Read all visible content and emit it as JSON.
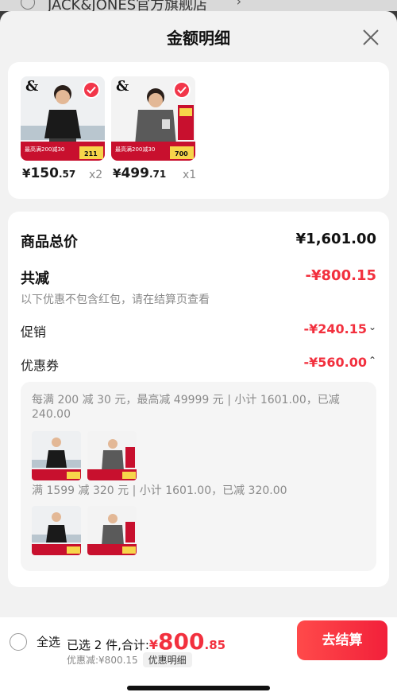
{
  "background_page": {
    "store_name": "JACK&JONES官方旗舰店"
  },
  "sheet": {
    "title": "金额明细"
  },
  "products": [
    {
      "price_yen": "¥",
      "price_int": "150",
      "price_dec": ".57",
      "qty": "x2",
      "label": "black shirt",
      "brand": "&",
      "promo": "最高满200减30",
      "tag": "211"
    },
    {
      "price_yen": "¥",
      "price_int": "499",
      "price_dec": ".71",
      "qty": "x1",
      "label": "grey down jacket",
      "brand": "&",
      "promo": "最高满200减30",
      "tag": "700"
    }
  ],
  "summary": {
    "total_label": "商品总价",
    "total_value": "¥1,601.00",
    "reduce_label": "共减",
    "reduce_value": "-¥800.15",
    "reduce_note": "以下优惠不包含红包，请在结算页查看",
    "promo_label": "促销",
    "promo_value": "-¥240.15",
    "coupon_label": "优惠券",
    "coupon_value": "-¥560.00"
  },
  "coupons": [
    {
      "text": "每满 200 减 30 元，最高减 49999 元 | 小计 1601.00，已减 240.00"
    },
    {
      "text": "满 1599 减 320 元 | 小计 1601.00，已减 320.00"
    }
  ],
  "bottom": {
    "select_all": "全选",
    "selected_text": "已选 2 件,合计:",
    "total_yen": "¥",
    "total_int": "800",
    "total_dec": ".85",
    "discount_text": "优惠减:¥800.15",
    "detail_chip": "优惠明细",
    "checkout": "去结算"
  },
  "colors": {
    "accent": "#f2303e",
    "check": "#f2364a"
  }
}
